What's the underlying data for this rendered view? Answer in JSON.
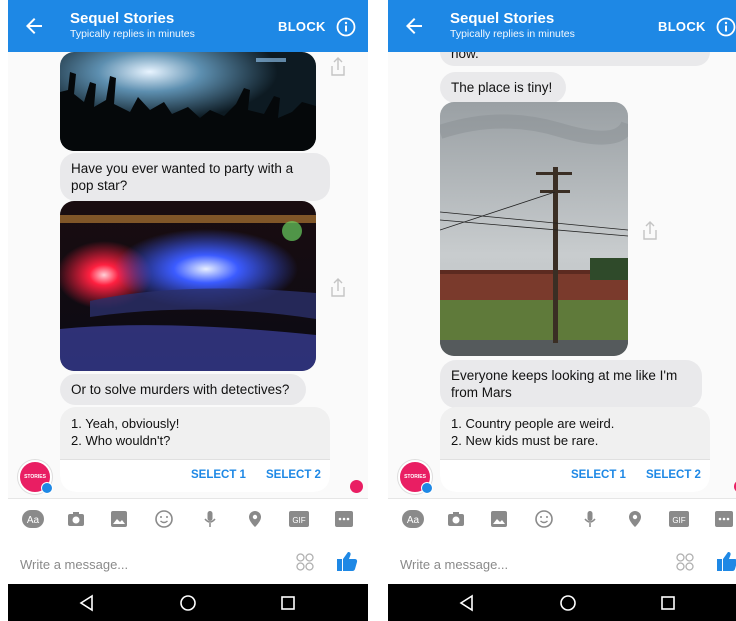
{
  "header": {
    "title": "Sequel Stories",
    "subtitle": "Typically replies in minutes",
    "block_label": "BLOCK"
  },
  "avatar": {
    "text": "STORIES"
  },
  "left_chat": {
    "messages": [
      "Have you ever wanted to party with a pop star?",
      "Or to solve murders with detectives?"
    ],
    "quick_reply": {
      "lines": [
        "1. Yeah, obviously!",
        "2. Who wouldn't?"
      ],
      "buttons": [
        "SELECT 1",
        "SELECT 2"
      ]
    }
  },
  "right_chat": {
    "partial_message": "now.",
    "messages": [
      "The place is tiny!",
      "Everyone keeps looking at me like I'm from Mars"
    ],
    "quick_reply": {
      "lines": [
        "1. Country people are weird.",
        "2. New kids must be rare."
      ],
      "buttons": [
        "SELECT 1",
        "SELECT 2"
      ]
    }
  },
  "composer": {
    "placeholder": "Write a message...",
    "icons": [
      "text-format-icon",
      "camera-icon",
      "gallery-icon",
      "emoji-icon",
      "microphone-icon",
      "location-icon",
      "gif-icon",
      "more-icon"
    ],
    "gif_label": "GIF",
    "aa_label": "Aa"
  },
  "colors": {
    "brand": "#1e88e5",
    "avatar": "#e91e63",
    "bubble": "#e9e9eb"
  }
}
